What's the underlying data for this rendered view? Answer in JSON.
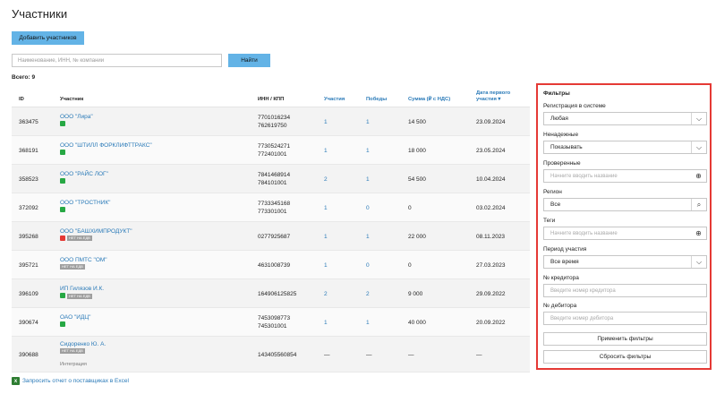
{
  "page": {
    "title": "Участники"
  },
  "toolbar": {
    "add_label": "Добавить участников"
  },
  "search": {
    "placeholder": "Наименование, ИНН, № компании",
    "button_label": "Найти"
  },
  "total": "Всего: 9",
  "table": {
    "headers": {
      "id": "ID",
      "participant": "Участник",
      "inn_kpp": "ИНН / КПП",
      "participations": "Участия",
      "wins": "Победы",
      "sum": "Сумма (₽ с НДС)",
      "first_date": "Дата первого участия ▾"
    },
    "rows": [
      {
        "id": "363475",
        "name": "ООО \"Лира\"",
        "status": "green",
        "tag": "",
        "sub": "",
        "inn": "7701016234",
        "kpp": "762619750",
        "participations": "1",
        "wins": "1",
        "sum": "14 500",
        "date": "23.09.2024"
      },
      {
        "id": "368191",
        "name": "ООО \"ШТИЛЛ ФОРКЛИФТТРАКС\"",
        "status": "green",
        "tag": "",
        "sub": "",
        "inn": "7730524271",
        "kpp": "772401001",
        "participations": "1",
        "wins": "1",
        "sum": "18 000",
        "date": "23.05.2024"
      },
      {
        "id": "358523",
        "name": "ООО \"РАЙС ЛОГ\"",
        "status": "green",
        "tag": "",
        "sub": "",
        "inn": "7841468914",
        "kpp": "784101001",
        "participations": "2",
        "wins": "1",
        "sum": "54 500",
        "date": "10.04.2024"
      },
      {
        "id": "372092",
        "name": "ООО \"ТРОСТНИК\"",
        "status": "green",
        "tag": "",
        "sub": "",
        "inn": "7733345168",
        "kpp": "773301001",
        "participations": "1",
        "wins": "0",
        "sum": "0",
        "date": "03.02.2024"
      },
      {
        "id": "395268",
        "name": "ООО \"БАШХИМПРОДУКТ\"",
        "status": "red",
        "tag": "НЕТ НА ЕДВ",
        "sub": "",
        "inn": "0277925687",
        "kpp": "",
        "participations": "1",
        "wins": "1",
        "sum": "22 000",
        "date": "08.11.2023"
      },
      {
        "id": "395721",
        "name": "ООО ПМТС \"ОМ\"",
        "status": "",
        "tag": "НЕТ НА ЕДВ",
        "sub": "",
        "inn": "4631008739",
        "kpp": "",
        "participations": "1",
        "wins": "0",
        "sum": "0",
        "date": "27.03.2023"
      },
      {
        "id": "396109",
        "name": "ИП Гилязов И.К.",
        "status": "green",
        "tag": "НЕТ НА ЕДВ",
        "sub": "",
        "inn": "164906125825",
        "kpp": "",
        "participations": "2",
        "wins": "2",
        "sum": "9 000",
        "date": "29.09.2022"
      },
      {
        "id": "390674",
        "name": "ОАО \"ИДЦ\"",
        "status": "green",
        "tag": "",
        "sub": "",
        "inn": "7453098773",
        "kpp": "745301001",
        "participations": "1",
        "wins": "1",
        "sum": "40 000",
        "date": "20.09.2022"
      },
      {
        "id": "390688",
        "name": "Сидоренко Ю. А.",
        "status": "",
        "tag": "НЕТ НА ЕДВ",
        "sub": "Интеграция",
        "inn": "143405560854",
        "kpp": "",
        "participations": "—",
        "wins": "—",
        "sum": "—",
        "date": "—"
      }
    ]
  },
  "excel": {
    "label": "Запросить отчет о поставщиках в Excel"
  },
  "filters": {
    "title": "Фильтры",
    "registration": {
      "label": "Регистрация в системе",
      "value": "Любая"
    },
    "unreliable": {
      "label": "Ненадежные",
      "value": "Показывать"
    },
    "verified": {
      "label": "Проверенные",
      "placeholder": "Начните вводить название"
    },
    "region": {
      "label": "Регион",
      "value": "Все"
    },
    "tags": {
      "label": "Теги",
      "placeholder": "Начните вводить название"
    },
    "period": {
      "label": "Период участия",
      "value": "Все время"
    },
    "creditor": {
      "label": "№ кредитора",
      "placeholder": "Введите номер кредитора"
    },
    "debtor": {
      "label": "№ дебитора",
      "placeholder": "Введите номер дебитора"
    },
    "apply_label": "Применить фильтры",
    "reset_label": "Сбросить фильтры"
  },
  "colors": {
    "accent": "#63b3e6",
    "link": "#2a7ab8",
    "filter_border": "#e53935",
    "status_ok": "#27a844",
    "status_bad": "#e53935"
  }
}
